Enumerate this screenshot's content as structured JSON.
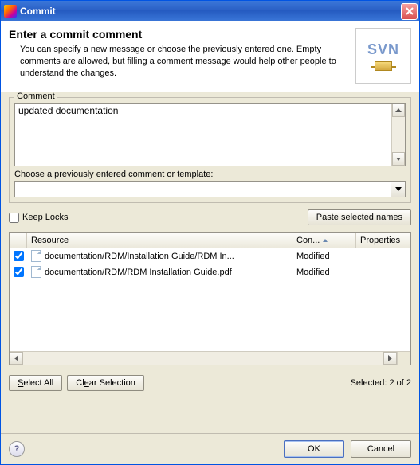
{
  "window": {
    "title": "Commit"
  },
  "header": {
    "title": "Enter a commit comment",
    "desc": "You can specify a new message or choose the previously entered one. Empty comments are allowed, but filling a comment message would help other people to understand the changes.",
    "logo_text": "SVN"
  },
  "comment": {
    "legend_pre": "Co",
    "legend_u": "m",
    "legend_post": "ment",
    "value": "updated documentation",
    "prev_label_pre": "",
    "prev_label_u": "C",
    "prev_label_post": "hoose a previously entered comment or template:",
    "combo_value": ""
  },
  "options": {
    "keep_locks_pre": "Keep ",
    "keep_locks_u": "L",
    "keep_locks_post": "ocks",
    "keep_locks_checked": false,
    "paste_pre": "",
    "paste_u": "P",
    "paste_post": "aste selected names"
  },
  "table": {
    "col_resource": "Resource",
    "col_content": "Con...",
    "col_properties": "Properties",
    "rows": [
      {
        "checked": true,
        "resource": "documentation/RDM/Installation Guide/RDM In...",
        "content": "Modified",
        "properties": ""
      },
      {
        "checked": true,
        "resource": "documentation/RDM/RDM Installation Guide.pdf",
        "content": "Modified",
        "properties": ""
      }
    ]
  },
  "selection": {
    "select_all_pre": "",
    "select_all_u": "S",
    "select_all_post": "elect All",
    "clear_pre": "Cl",
    "clear_u": "e",
    "clear_post": "ar Selection",
    "status": "Selected: 2 of 2"
  },
  "footer": {
    "ok": "OK",
    "cancel": "Cancel"
  }
}
